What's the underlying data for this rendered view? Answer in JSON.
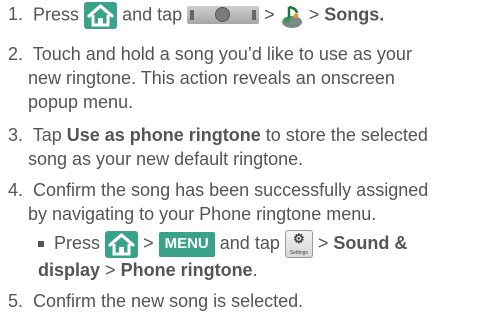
{
  "steps": [
    {
      "number": "1.",
      "press": "Press",
      "and_tap": "and tap",
      "gt1": ">",
      "gt2": ">",
      "target": "Songs",
      "target_end": "."
    },
    {
      "number": "2.",
      "lines": [
        "Touch and hold a song you’d like to use as your",
        "new ringtone. This action reveals an onscreen",
        "popup menu."
      ]
    },
    {
      "number": "3.",
      "tap": "Tap",
      "action": "Use as phone ringtone",
      "line1_rest": "to store the selected",
      "line2": "song as your new default ringtone."
    },
    {
      "number": "4.",
      "lines": [
        "Confirm the song has been successfully assigned",
        "by navigating to your Phone ringtone menu."
      ],
      "sub": {
        "press": "Press",
        "gt1": ">",
        "menu_key": "MENU",
        "and_tap": "and tap",
        "settings_icon_label": "Settings",
        "gt2": ">",
        "item1_line1": "Sound &",
        "item1_line2": "display",
        "gt3": ">",
        "item2": "Phone ringtone",
        "end": "."
      }
    },
    {
      "number": "5.",
      "text": "Confirm the new song is selected."
    }
  ],
  "icons": {
    "home": "home-icon",
    "launcher": "launcher-tab-icon",
    "music": "music-app-icon",
    "settings": "settings-app-icon"
  },
  "colors": {
    "text": "#555555",
    "accent": "#3aa18a"
  }
}
